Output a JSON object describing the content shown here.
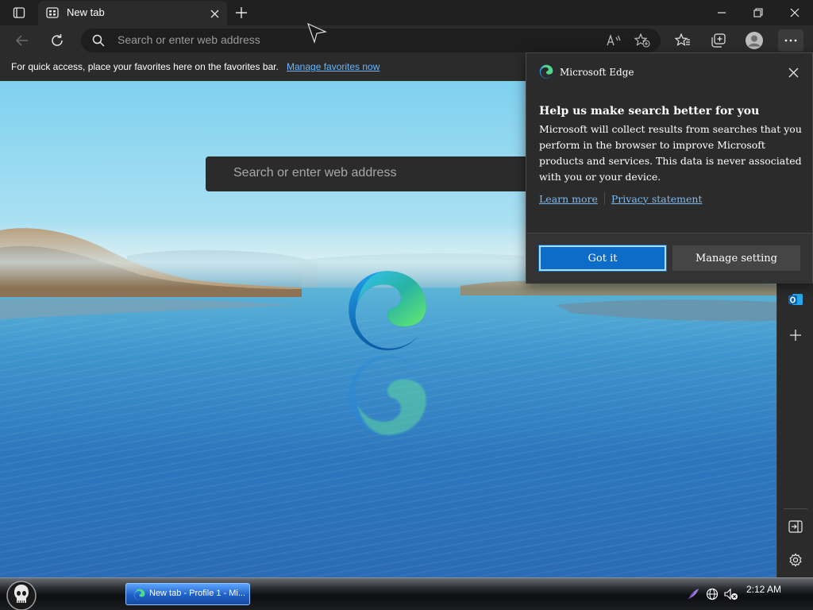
{
  "browser": {
    "tab": {
      "title": "New tab"
    },
    "address_bar": {
      "placeholder": "Search or enter web address"
    },
    "favorites_bar": {
      "message": "For quick access, place your favorites here on the favorites bar.",
      "link": "Manage favorites now"
    },
    "page": {
      "search_placeholder": "Search or enter web address"
    }
  },
  "popup": {
    "app_name": "Microsoft Edge",
    "heading": "Help us make search better for you",
    "body": "Microsoft will collect results from searches that you perform in the browser to improve Microsoft products and services. This data is never associated with you or your device.",
    "learn_more": "Learn more",
    "privacy": "Privacy statement",
    "primary_button": "Got it",
    "secondary_button": "Manage setting"
  },
  "taskbar": {
    "task_item_label": "New tab - Profile 1 - Mi...",
    "clock": "2:12 AM"
  },
  "icons": {
    "tab_actions": "tab-actions-icon",
    "new_tab": "plus-icon",
    "back": "back-arrow-icon",
    "refresh": "refresh-icon",
    "read_aloud": "read-aloud-icon",
    "add_favorite": "star-plus-icon",
    "favorites": "favorites-icon",
    "collections": "collections-icon",
    "profile": "profile-avatar-icon",
    "more": "more-dots-icon",
    "outlook": "outlook-icon",
    "settings": "gear-icon"
  },
  "colors": {
    "accent": "#0e6cc9",
    "link": "#7db9ec",
    "chrome_dark": "#202020",
    "chrome": "#2b2b2b"
  }
}
